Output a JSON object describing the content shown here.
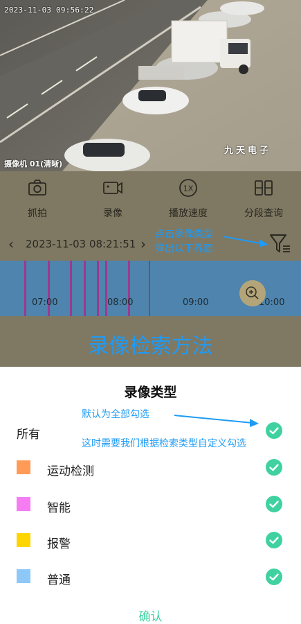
{
  "camera": {
    "timestamp": "2023-11-03 09:56:22",
    "name": "摄像机 01(清晰)",
    "brand": "九天电子"
  },
  "toolbar": {
    "items": [
      {
        "label": "抓拍",
        "icon": "camera-icon"
      },
      {
        "label": "录像",
        "icon": "video-camera-icon"
      },
      {
        "label": "播放速度",
        "icon": "speed-1x-icon"
      },
      {
        "label": "分段查询",
        "icon": "segment-icon"
      }
    ]
  },
  "date_bar": {
    "date": "2023-11-03 08:21:51",
    "prev": "‹",
    "next": "›"
  },
  "annotations": {
    "filter_note_line1": "点击录像类型",
    "filter_note_line2": "弹出以下界面",
    "default_note": "默认为全部勾选",
    "custom_note": "这时需要我们根据检索类型自定义勾选"
  },
  "timeline": {
    "labels": [
      "07:00",
      "08:00",
      "09:00",
      "10:00"
    ]
  },
  "method_title": "录像检索方法",
  "sheet": {
    "title": "录像类型",
    "all_label": "所有",
    "types": [
      {
        "label": "运动检测",
        "color": "#ff9a57"
      },
      {
        "label": "智能",
        "color": "#f57cf2"
      },
      {
        "label": "报警",
        "color": "#ffd500"
      },
      {
        "label": "普通",
        "color": "#8dc8f8"
      }
    ],
    "confirm": "确认"
  },
  "colors": {
    "accent": "#1e9bf5",
    "check": "#3fd2a0",
    "dim_overlay": "#7f7863"
  }
}
